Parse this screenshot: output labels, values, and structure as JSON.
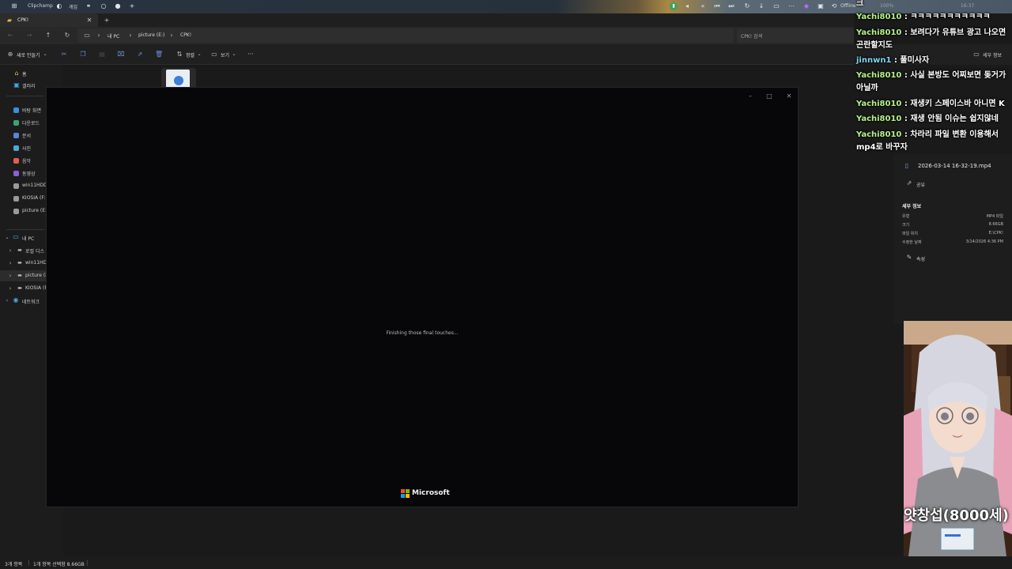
{
  "taskbar": {
    "clipchamp": "Clipchamp",
    "game": "게임",
    "offline": "Offline",
    "battery": "100%",
    "time": "16:37"
  },
  "tab": {
    "title": "CPK!"
  },
  "nav": {
    "crumbs": [
      "내 PC",
      "picture (E:)",
      "CPK!"
    ],
    "search_placeholder": "CPK! 검색"
  },
  "commands": {
    "new": "새로 만들기",
    "sort": "정렬",
    "view": "보기",
    "more": "···",
    "details": "세부 정보"
  },
  "sidebar": {
    "home": "홈",
    "gallery": "갤러리",
    "quick": [
      {
        "label": "바탕 화면",
        "color": "#3a8ee6"
      },
      {
        "label": "다운로드",
        "color": "#3ea36b"
      },
      {
        "label": "문서",
        "color": "#5a84d8"
      },
      {
        "label": "사진",
        "color": "#4aa7e0"
      },
      {
        "label": "음악",
        "color": "#e0604e"
      },
      {
        "label": "동영상",
        "color": "#8a5fd8"
      },
      {
        "label": "win11HDD",
        "color": "#9a9a9a"
      },
      {
        "label": "KIOSIA (F:)",
        "color": "#9a9a9a"
      },
      {
        "label": "picture (E:)",
        "color": "#9a9a9a"
      }
    ],
    "this_pc": "내 PC",
    "tree": [
      "로컬 디스",
      "win11HDI",
      "picture (E",
      "KIOSIA (F"
    ],
    "network": "네트워크"
  },
  "modal": {
    "loading_text": "Finishing those final touches...",
    "brand": "Microsoft"
  },
  "details": {
    "filename": "2026-03-14 16-32-19.mp4",
    "share": "공유",
    "section": "세부 정보",
    "rows": [
      {
        "label": "유형",
        "value": "MP4 파일"
      },
      {
        "label": "크기",
        "value": "8.66GB"
      },
      {
        "label": "파일 위치",
        "value": "E:\\CPK!"
      },
      {
        "label": "수정한 날짜",
        "value": "3/14/2026 4:36 PM"
      }
    ],
    "properties": "속성"
  },
  "status": {
    "items": "3개 항목",
    "selected": "1개 항목 선택함 8.66GB"
  },
  "chat": [
    {
      "user": "",
      "text": "크"
    },
    {
      "user": "Yachi8010",
      "text": "ㅋㅋㅋㅋㅋㅋㅋㅋㅋㅋㅋ"
    },
    {
      "user": "Yachi8010",
      "text": "보려다가 유튜브 광고 나오면 곤란할지도"
    },
    {
      "user": "jinnwn1",
      "text": "풀미사자"
    },
    {
      "user": "Yachi8010",
      "text": "사실 본방도 어찌보면 돚거가 아닐까"
    },
    {
      "user": "Yachi8010",
      "text": "재생키 스페이스바 아니면 K"
    },
    {
      "user": "Yachi8010",
      "text": "재생 안됨 이슈는 쉽지않네"
    },
    {
      "user": "Yachi8010",
      "text": "차라리 파일 변환 이용해서 mp4로 바꾸자"
    }
  ],
  "streamer": {
    "name": "얏창섭(8000세)"
  }
}
